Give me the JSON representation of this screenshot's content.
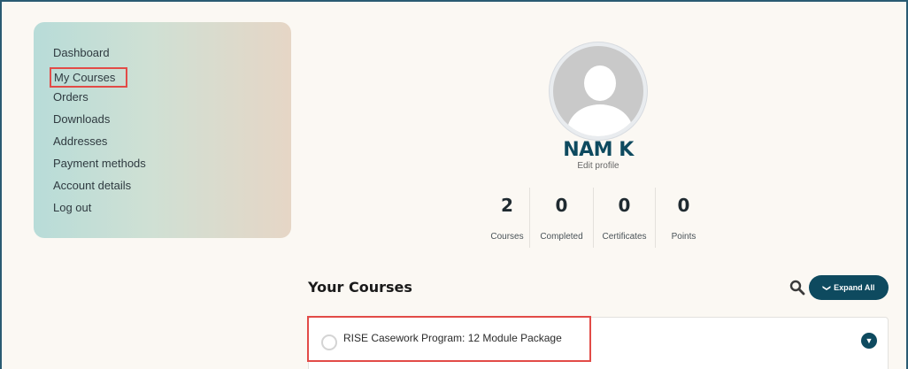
{
  "sidebar": {
    "items": [
      {
        "label": "Dashboard"
      },
      {
        "label": "My Courses"
      },
      {
        "label": "Orders"
      },
      {
        "label": "Downloads"
      },
      {
        "label": "Addresses"
      },
      {
        "label": "Payment methods"
      },
      {
        "label": "Account details"
      },
      {
        "label": "Log out"
      }
    ]
  },
  "profile": {
    "name": "NAM K",
    "edit_label": "Edit profile",
    "avatar_icon": "user-silhouette-icon"
  },
  "stats": [
    {
      "value": "2",
      "label": "Courses"
    },
    {
      "value": "0",
      "label": "Completed"
    },
    {
      "value": "0",
      "label": "Certificates"
    },
    {
      "value": "0",
      "label": "Points"
    }
  ],
  "courses_section": {
    "title": "Your Courses",
    "expand_all_label": "Expand All",
    "search_icon": "search-icon",
    "items": [
      {
        "title": "RISE Casework Program: 12 Module Package"
      }
    ]
  },
  "colors": {
    "accent": "#0e4a5f",
    "highlight": "#e24b47",
    "background": "#fbf8f3"
  }
}
